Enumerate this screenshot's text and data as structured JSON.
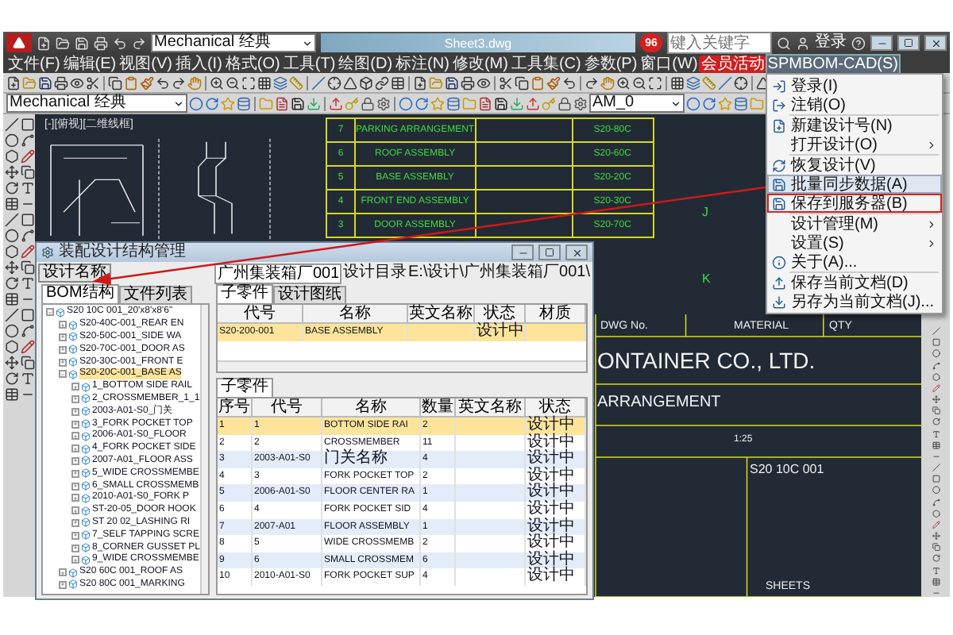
{
  "title_bar": {
    "workspace": "Mechanical 经典",
    "document": "Sheet3.dwg",
    "badge": "96",
    "search_placeholder": "键入关键字",
    "login": "登录"
  },
  "menu_bar": {
    "items": [
      {
        "label": "文件(F)",
        "selected": false
      },
      {
        "label": "编辑(E)",
        "selected": false
      },
      {
        "label": "视图(V)",
        "selected": false
      },
      {
        "label": "插入(I)",
        "selected": false
      },
      {
        "label": "格式(O)",
        "selected": false
      },
      {
        "label": "工具(T)",
        "selected": false
      },
      {
        "label": "绘图(D)",
        "selected": false
      },
      {
        "label": "标注(N)",
        "selected": false
      },
      {
        "label": "修改(M)",
        "selected": false
      },
      {
        "label": "工具集(C)",
        "selected": false
      },
      {
        "label": "参数(P)",
        "selected": false
      },
      {
        "label": "窗口(W)",
        "selected": false
      }
    ],
    "promo": "会员活动",
    "addon": {
      "label": "SPMBOM-CAD(S)",
      "selected": true
    }
  },
  "toolbar": {
    "style_dropdown": "Mechanical 经典",
    "layer_dropdown": "AM_0"
  },
  "drawing": {
    "viewport_label": "[-][俯视][二维线框]",
    "parts_table": [
      {
        "no": "7",
        "name": "PARKING ARRANGEMENT",
        "code": "S20-80C"
      },
      {
        "no": "6",
        "name": "ROOF ASSEMBLY",
        "code": "S20-60C"
      },
      {
        "no": "5",
        "name": "BASE ASSEMBLY",
        "code": "S20-20C"
      },
      {
        "no": "4",
        "name": "FRONT END ASSEMBLY",
        "code": "S20-30C"
      },
      {
        "no": "3",
        "name": "DOOR ASSEMBLY",
        "code": "S20-70C"
      }
    ],
    "title_block": {
      "dwg_no": "DWG No.",
      "material": "MATERIAL",
      "qty": "QTY",
      "company": "ONTAINER CO., LTD.",
      "title": "ARRANGEMENT",
      "scale": "1:25",
      "number": "S20 10C 001",
      "sheets": "SHEETS"
    },
    "zone_labels": [
      "J",
      "K"
    ]
  },
  "dropdown_menu": [
    {
      "label": "登录(I)",
      "kind": "item",
      "selected": false,
      "outlined": false
    },
    {
      "label": "注销(O)",
      "kind": "item",
      "selected": false,
      "outlined": false
    },
    {
      "label": "新建设计号(N)",
      "kind": "item",
      "selected": false,
      "outlined": false
    },
    {
      "label": "打开设计(O)",
      "kind": "submenu",
      "selected": false,
      "outlined": false
    },
    {
      "label": "恢复设计(V)",
      "kind": "item",
      "selected": false,
      "outlined": false
    },
    {
      "label": "批量同步数据(A)",
      "kind": "item",
      "selected": true,
      "outlined": false
    },
    {
      "label": "保存到服务器(B)",
      "kind": "item",
      "selected": false,
      "outlined": true
    },
    {
      "label": "设计管理(M)",
      "kind": "submenu",
      "selected": false,
      "outlined": false
    },
    {
      "label": "设置(S)",
      "kind": "submenu",
      "selected": false,
      "outlined": false
    },
    {
      "label": "关于(A)...",
      "kind": "item",
      "selected": false,
      "outlined": false
    },
    {
      "label": "保存当前文档(D)",
      "kind": "item",
      "selected": false,
      "outlined": false
    },
    {
      "label": "另存为当前文档(J)...",
      "kind": "item",
      "selected": false,
      "outlined": false
    }
  ],
  "dialog": {
    "title": "装配设计结构管理",
    "name_button": "设计名称",
    "name_value": "广州集装箱厂001",
    "dir_label": "设计目录",
    "dir_value": "E:\\设计\\广州集装箱厂001\\",
    "left_tabs": [
      {
        "label": "BOM结构",
        "selected": true
      },
      {
        "label": "文件列表",
        "selected": false
      }
    ],
    "tree": [
      {
        "label": "S20 10C 001_20'x8'x8'6\"",
        "expanded": true,
        "selected": false,
        "children": [
          {
            "label": "S20-40C-001_REAR EN",
            "expanded": false,
            "selected": false
          },
          {
            "label": "S20-50C-001_SIDE WA",
            "expanded": false,
            "selected": false
          },
          {
            "label": "S20-70C-001_DOOR AS",
            "expanded": false,
            "selected": false
          },
          {
            "label": "S20-30C-001_FRONT E",
            "expanded": false,
            "selected": false
          },
          {
            "label": "S20-20C-001_BASE AS",
            "expanded": true,
            "selected": true,
            "children": [
              {
                "label": "1_BOTTOM SIDE RAIL",
                "expanded": false,
                "selected": false
              },
              {
                "label": "2_CROSSMEMBER_1_1",
                "expanded": false,
                "selected": false
              },
              {
                "label": "2003-A01-S0_门关",
                "expanded": false,
                "selected": false
              },
              {
                "label": "3_FORK POCKET TOP",
                "expanded": false,
                "selected": false
              },
              {
                "label": "2006-A01-S0_FLOOR",
                "expanded": false,
                "selected": false
              },
              {
                "label": "4_FORK POCKET SIDE",
                "expanded": false,
                "selected": false
              },
              {
                "label": "2007-A01_FLOOR ASS",
                "expanded": false,
                "selected": false
              },
              {
                "label": "5_WIDE CROSSMEMBE",
                "expanded": false,
                "selected": false
              },
              {
                "label": "6_SMALL CROSSMEMB",
                "expanded": false,
                "selected": false
              },
              {
                "label": "2010-A01-S0_FORK P",
                "expanded": false,
                "selected": false
              },
              {
                "label": "ST-20-05_DOOR HOOK",
                "expanded": false,
                "selected": false
              },
              {
                "label": "ST 20 02_LASHING RI",
                "expanded": false,
                "selected": false
              },
              {
                "label": "7_SELF TAPPING SCRE",
                "expanded": false,
                "selected": false
              },
              {
                "label": "8_CORNER GUSSET PL",
                "expanded": false,
                "selected": false
              },
              {
                "label": "9_WIDE CROSSMEMBE",
                "expanded": false,
                "selected": false
              }
            ]
          },
          {
            "label": "S20 60C 001_ROOF AS",
            "expanded": false,
            "selected": false
          },
          {
            "label": "S20 80C 001_MARKING",
            "expanded": false,
            "selected": false
          }
        ]
      }
    ],
    "right_tabs": [
      {
        "label": "子零件",
        "selected": true
      },
      {
        "label": "设计图纸",
        "selected": false
      }
    ],
    "parent_table": {
      "columns": [
        "代号",
        "名称",
        "英文名称",
        "状态",
        "材质"
      ],
      "rows": [
        {
          "cells": [
            "S20-200-001",
            "BASE ASSEMBLY",
            "",
            "设计中",
            ""
          ],
          "selected": true
        }
      ]
    },
    "child_tab": "子零件",
    "child_table": {
      "columns": [
        "序号",
        "代号",
        "名称",
        "数量",
        "英文名称",
        "状态"
      ],
      "rows": [
        {
          "cells": [
            "1",
            "1",
            "BOTTOM SIDE RAI",
            "2",
            "",
            "设计中"
          ],
          "selected": true
        },
        {
          "cells": [
            "2",
            "2",
            "CROSSMEMBER",
            "11",
            "",
            "设计中"
          ],
          "selected": false
        },
        {
          "cells": [
            "3",
            "2003-A01-S0",
            "门关名称",
            "4",
            "",
            "设计中"
          ],
          "selected": false
        },
        {
          "cells": [
            "4",
            "3",
            "FORK POCKET TOP",
            "2",
            "",
            "设计中"
          ],
          "selected": false
        },
        {
          "cells": [
            "5",
            "2006-A01-S0",
            "FLOOR CENTER RA",
            "1",
            "",
            "设计中"
          ],
          "selected": false
        },
        {
          "cells": [
            "6",
            "4",
            "FORK POCKET SID",
            "4",
            "",
            "设计中"
          ],
          "selected": false
        },
        {
          "cells": [
            "7",
            "2007-A01",
            "FLOOR ASSEMBLY",
            "1",
            "",
            "设计中"
          ],
          "selected": false
        },
        {
          "cells": [
            "8",
            "5",
            "WIDE CROSSMEMB",
            "2",
            "",
            "设计中"
          ],
          "selected": false
        },
        {
          "cells": [
            "9",
            "6",
            "SMALL CROSSMEM",
            "6",
            "",
            "设计中"
          ],
          "selected": false
        },
        {
          "cells": [
            "10",
            "2010-A01-S0",
            "FORK POCKET SUP",
            "4",
            "",
            "设计中"
          ],
          "selected": false
        }
      ]
    }
  }
}
